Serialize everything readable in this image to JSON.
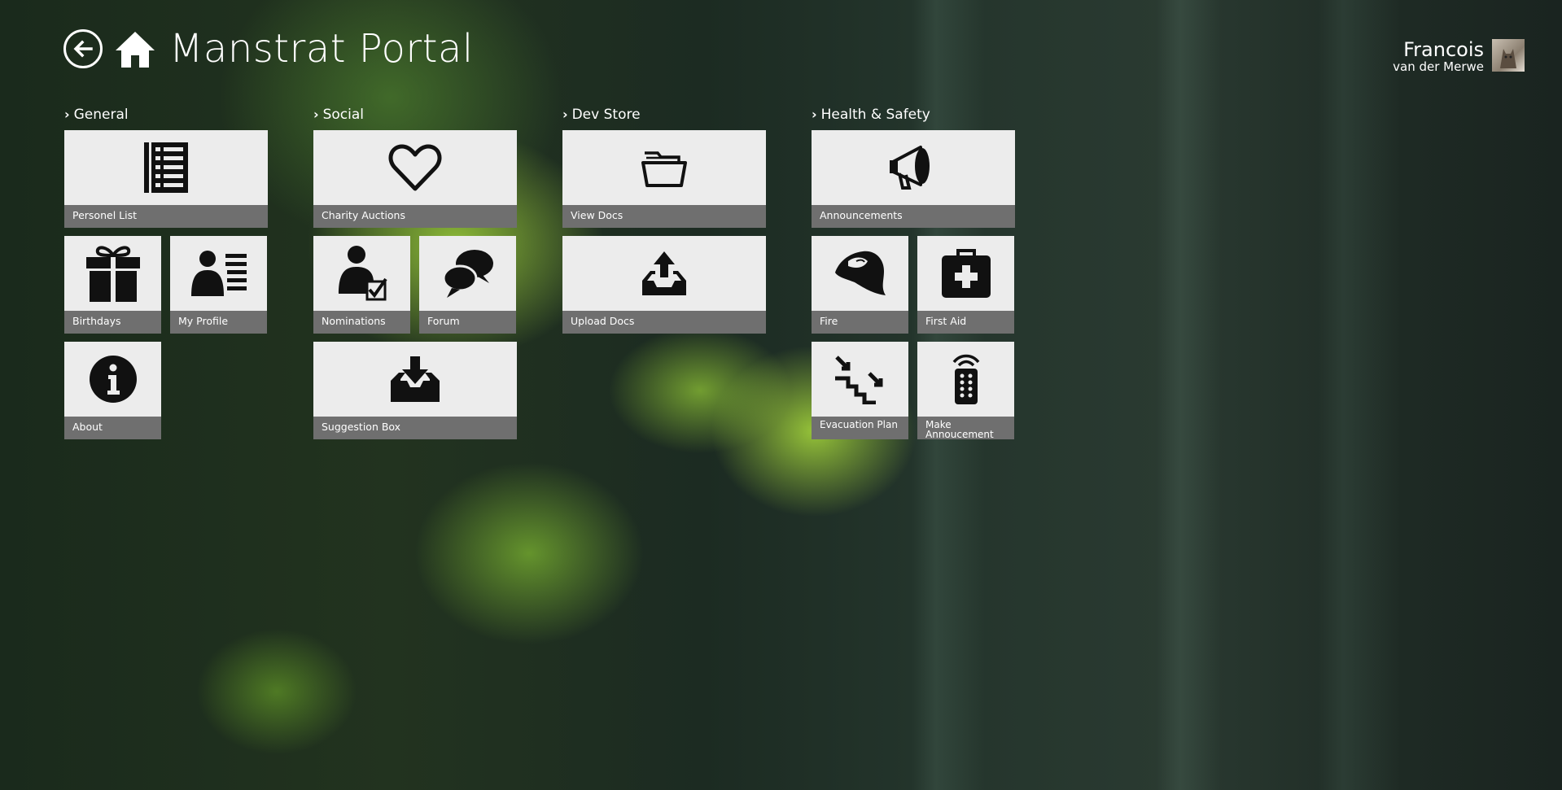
{
  "header": {
    "back_icon": "back-arrow-icon",
    "home_icon": "home-icon",
    "title": "Manstrat Portal"
  },
  "user": {
    "first_name": "Francois",
    "last_name": "van der Merwe",
    "avatar_icon": "avatar"
  },
  "groups": [
    {
      "title": "General",
      "tiles": [
        {
          "label": "Personel List",
          "icon": "list-icon"
        },
        {
          "label": "Birthdays",
          "icon": "gift-icon"
        },
        {
          "label": "My Profile",
          "icon": "profile-icon"
        },
        {
          "label": "About",
          "icon": "info-icon"
        }
      ]
    },
    {
      "title": "Social",
      "tiles": [
        {
          "label": "Charity Auctions",
          "icon": "heart-icon"
        },
        {
          "label": "Nominations",
          "icon": "user-check-icon"
        },
        {
          "label": "Forum",
          "icon": "chat-bubbles-icon"
        },
        {
          "label": "Suggestion Box",
          "icon": "inbox-download-icon"
        }
      ]
    },
    {
      "title": "Dev Store",
      "tiles": [
        {
          "label": "View Docs",
          "icon": "folder-icon"
        },
        {
          "label": "Upload Docs",
          "icon": "upload-icon"
        }
      ]
    },
    {
      "title": "Health & Safety",
      "tiles": [
        {
          "label": "Announcements",
          "icon": "megaphone-icon"
        },
        {
          "label": "Fire",
          "icon": "fire-helmet-icon"
        },
        {
          "label": "First Aid",
          "icon": "first-aid-icon"
        },
        {
          "label": "Evacuation Plan",
          "icon": "stairs-exit-icon"
        },
        {
          "label": "Make Annoucement",
          "icon": "remote-icon"
        }
      ]
    }
  ]
}
